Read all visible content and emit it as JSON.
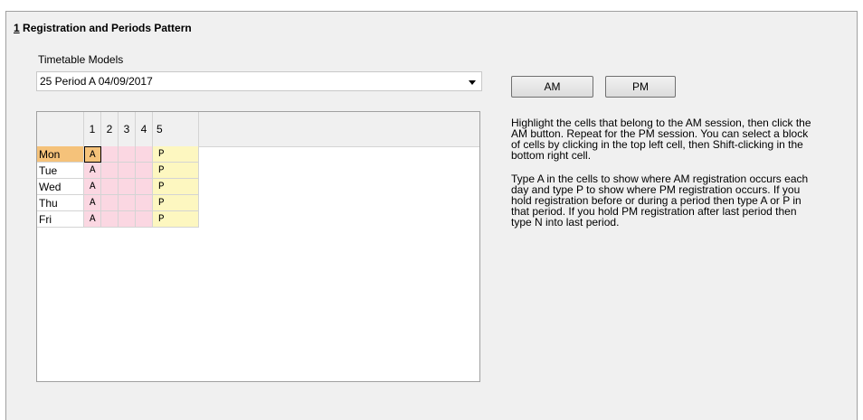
{
  "section": {
    "number": "1",
    "title": " Registration and Periods Pattern"
  },
  "models": {
    "label": "Timetable Models",
    "selected": "25 Period A 04/09/2017"
  },
  "buttons": {
    "am": "AM",
    "pm": "PM"
  },
  "help": {
    "p1": "Highlight the cells that belong to the AM session, then click the AM button. Repeat for the PM session. You can select a block of cells by clicking in the top left cell, then Shift-clicking in the bottom right cell.",
    "p2": "Type A in the cells to show where AM registration occurs each day and type P to show where PM registration occurs. If you hold registration before or during a period then type A or P in that period. If you hold PM registration after last period then type N into last period."
  },
  "grid": {
    "columns": [
      "1",
      "2",
      "3",
      "4",
      "5"
    ],
    "rows": [
      {
        "day": "Mon",
        "cells": [
          "A",
          "",
          "",
          "",
          "P"
        ]
      },
      {
        "day": "Tue",
        "cells": [
          "A",
          "",
          "",
          "",
          "P"
        ]
      },
      {
        "day": "Wed",
        "cells": [
          "A",
          "",
          "",
          "",
          "P"
        ]
      },
      {
        "day": "Thu",
        "cells": [
          "A",
          "",
          "",
          "",
          "P"
        ]
      },
      {
        "day": "Fri",
        "cells": [
          "A",
          "",
          "",
          "",
          "P"
        ]
      }
    ]
  }
}
